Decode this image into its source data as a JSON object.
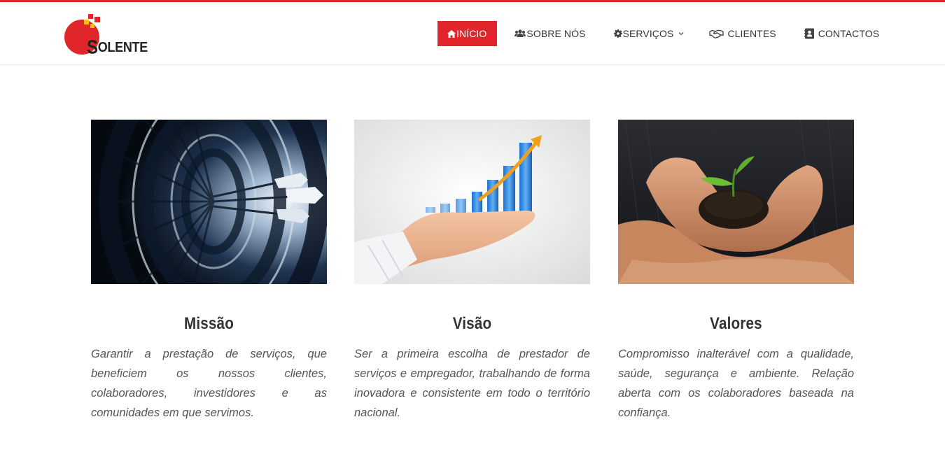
{
  "brand": {
    "name": "SOLENTE",
    "first_letter": "S",
    "rest": "OLENTE"
  },
  "nav": {
    "items": [
      {
        "key": "home",
        "label": "INÍCIO",
        "icon": "home-icon",
        "active": true
      },
      {
        "key": "about",
        "label": "SOBRE NÓS",
        "icon": "users-icon"
      },
      {
        "key": "services",
        "label": "SERVIÇOS",
        "icon": "gear-icon",
        "dropdown": true
      },
      {
        "key": "clients",
        "label": "CLIENTES",
        "icon": "handshake-icon"
      },
      {
        "key": "contacts",
        "label": "CONTACTOS",
        "icon": "address-book-icon"
      }
    ]
  },
  "cards": [
    {
      "title": "Missão",
      "image": "dartboard-image",
      "text": "Garantir a prestação de serviços, que beneficiem os nossos clientes, colaboradores, investidores e as comunidades em que servimos."
    },
    {
      "title": "Visão",
      "image": "growth-chart-hand-image",
      "text": "Ser a primeira escolha de prestador de serviços e empregador, trabalhando de forma inovadora e consistente em todo o território nacional."
    },
    {
      "title": "Valores",
      "image": "hands-holding-plant-image",
      "text": "Compromisso inalterável com a qualidade, saúde, segurança e ambiente. Relação aberta com os colaboradores baseada na confiança."
    }
  ],
  "colors": {
    "accent": "#e0262a",
    "logo_yellow": "#f7c21b",
    "text": "#333333"
  }
}
